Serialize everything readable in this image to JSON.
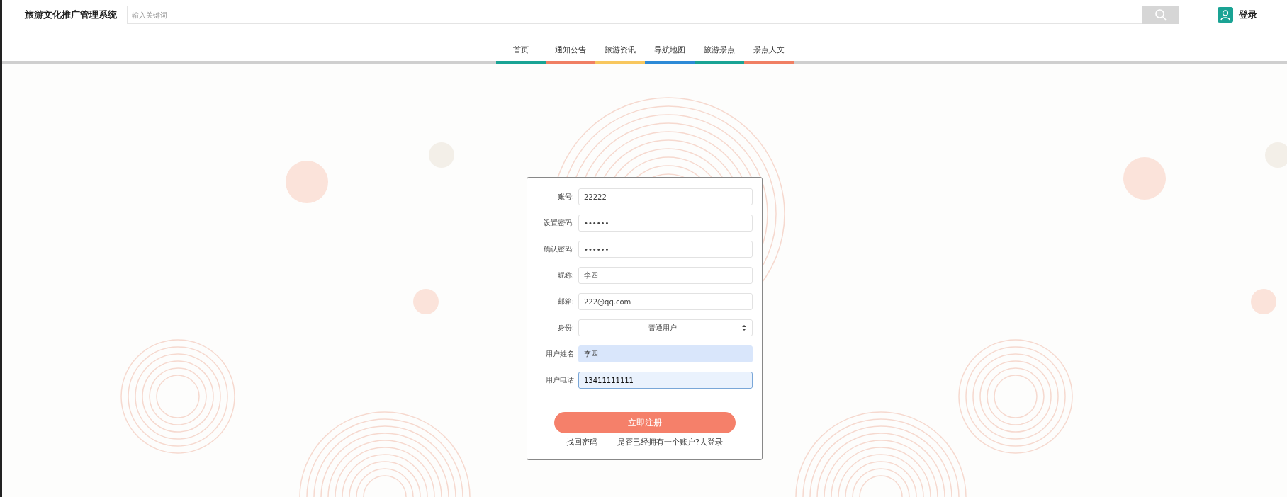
{
  "header": {
    "site_title": "旅游文化推广管理系统",
    "search": {
      "placeholder": "输入关键词"
    },
    "login_link": "登录"
  },
  "nav": [
    {
      "label": "首页",
      "color": "#1aa394"
    },
    {
      "label": "通知公告",
      "color": "#f07f63"
    },
    {
      "label": "旅游资讯",
      "color": "#f8c75e"
    },
    {
      "label": "导航地图",
      "color": "#2d8ad6"
    },
    {
      "label": "旅游景点",
      "color": "#1aa394"
    },
    {
      "label": "景点人文",
      "color": "#f07f63"
    }
  ],
  "form": {
    "fields": [
      {
        "label": "账号:",
        "kind": "text",
        "value": "22222",
        "autofilled": false,
        "focused": false
      },
      {
        "label": "设置密码:",
        "kind": "text",
        "value": "••••••",
        "autofilled": false,
        "focused": false
      },
      {
        "label": "确认密码:",
        "kind": "text",
        "value": "••••••",
        "autofilled": false,
        "focused": false
      },
      {
        "label": "昵称:",
        "kind": "text",
        "value": "李四",
        "autofilled": false,
        "focused": false
      },
      {
        "label": "邮箱:",
        "kind": "text",
        "value": "222@qq.com",
        "autofilled": false,
        "focused": false
      },
      {
        "label": "身份:",
        "kind": "select",
        "value": "普通用户",
        "autofilled": false,
        "focused": false
      },
      {
        "label": "用户姓名",
        "kind": "text",
        "value": "李四",
        "autofilled": true,
        "focused": false
      },
      {
        "label": "用户电话",
        "kind": "text",
        "value": "13411111111",
        "autofilled": false,
        "focused": true
      }
    ],
    "submit": "立即注册",
    "links": [
      "找回密码",
      "是否已经拥有一个账户?去登录"
    ]
  }
}
